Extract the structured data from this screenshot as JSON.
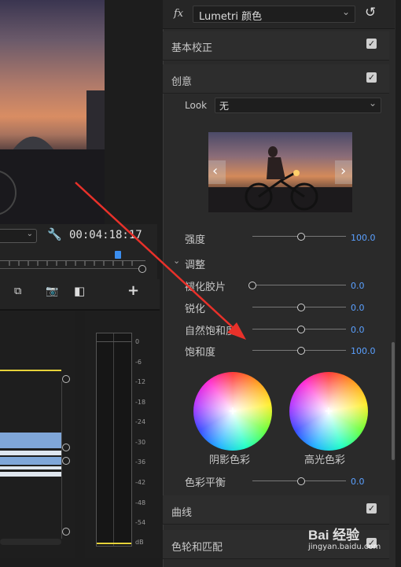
{
  "monitor": {
    "timecode": "00:04:18:17"
  },
  "meter": {
    "ticks": [
      "0",
      "-6",
      "-12",
      "-18",
      "-24",
      "-30",
      "-36",
      "-42",
      "-48",
      "-54",
      "dB"
    ]
  },
  "panel": {
    "fx_label": "fx",
    "effect_name": "Lumetri 颜色",
    "sections": {
      "basic": "基本校正",
      "creative": "创意",
      "curves": "曲线",
      "wheels": "色轮和匹配"
    },
    "look": {
      "label": "Look",
      "value": "无"
    },
    "intensity": {
      "label": "强度",
      "value": "100.0",
      "level": 0.5
    },
    "adjust": {
      "title": "调整"
    },
    "faded_film": {
      "label": "褪化胶片",
      "value": "0.0",
      "level": 0.0
    },
    "sharpen": {
      "label": "锐化",
      "value": "0.0",
      "level": 0.5
    },
    "vibrance": {
      "label": "自然饱和度",
      "value": "0.0",
      "level": 0.5
    },
    "saturation": {
      "label": "饱和度",
      "value": "100.0",
      "level": 0.5
    },
    "shadow_tint": {
      "label": "阴影色彩"
    },
    "highlight_tint": {
      "label": "高光色彩"
    },
    "tint_balance": {
      "label": "色彩平衡",
      "value": "0.0",
      "level": 0.5
    }
  },
  "watermark": {
    "text": "Bai 经验",
    "url": "jingyan.baidu.com"
  },
  "colors": {
    "accent": "#5aa0ff",
    "arrow": "#e8312a"
  }
}
